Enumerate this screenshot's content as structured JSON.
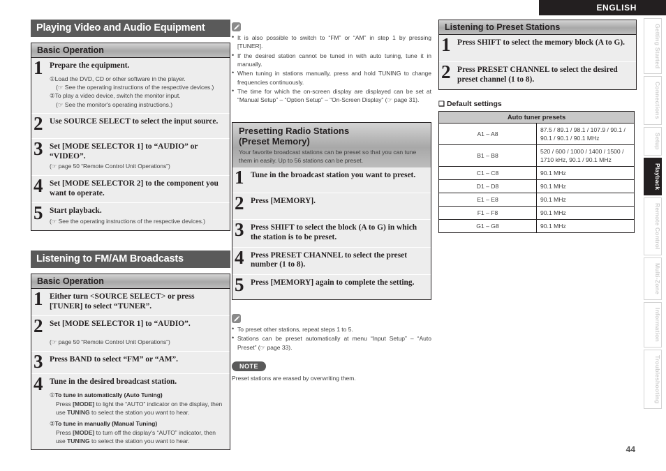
{
  "header": {
    "language_label": "ENGLISH",
    "page_number": "44"
  },
  "side_tabs": [
    {
      "label": "Getting Started",
      "active": false
    },
    {
      "label": "Connections",
      "active": false
    },
    {
      "label": "Setup",
      "active": false
    },
    {
      "label": "Playback",
      "active": true
    },
    {
      "label": "Remote Control",
      "active": false
    },
    {
      "label": "Multi-Zone",
      "active": false
    },
    {
      "label": "Information",
      "active": false
    },
    {
      "label": "Troubleshooting",
      "active": false
    }
  ],
  "column1": {
    "section1": {
      "heading": "Playing Video and Audio Equipment",
      "panel_heading": "Basic Operation",
      "steps": [
        {
          "num": "1",
          "title": "Prepare the equipment.",
          "items": [
            {
              "marker": "①",
              "text": "Load the DVD, CD or other software in the player."
            },
            {
              "marker": "",
              "text": "(☞ See the operating instructions of the respective devices.)"
            },
            {
              "marker": "②",
              "text": "To play a video device, switch the monitor input."
            },
            {
              "marker": "",
              "text": "(☞ See the monitor's operating instructions.)"
            }
          ]
        },
        {
          "num": "2",
          "title": "Use SOURCE SELECT to select the input source.",
          "sub": ""
        },
        {
          "num": "3",
          "title": "Set [MODE SELECTOR 1] to “AUDIO” or “VIDEO”.",
          "sub": "(☞ page 50 “Remote Control Unit Operations”)"
        },
        {
          "num": "4",
          "title": "Set [MODE SELECTOR 2] to the component you want to operate.",
          "sub": ""
        },
        {
          "num": "5",
          "title": "Start playback.",
          "sub": "(☞ See the operating instructions of the respective devices.)"
        }
      ]
    },
    "section2": {
      "heading": "Listening to FM/AM Broadcasts",
      "panel_heading": "Basic Operation",
      "steps": [
        {
          "num": "1",
          "title": "Either turn <SOURCE SELECT> or press [TUNER] to select “TUNER”.",
          "sub": ""
        },
        {
          "num": "2",
          "title": "Set [MODE SELECTOR 1] to “AUDIO”.",
          "sub": "(☞ page 50 “Remote Control Unit Operations”)"
        },
        {
          "num": "3",
          "title": "Press BAND to select “FM” or “AM”.",
          "sub": ""
        },
        {
          "num": "4",
          "title": "Tune in the desired broadcast station.",
          "tuning": [
            {
              "marker": "①",
              "label": "To tune in automatically (Auto Tuning)",
              "text_a": "Press ",
              "key_a": "[MODE]",
              "text_b": " to light the “AUTO” indicator on the display, then use ",
              "key_b": "TUNING",
              "text_c": " to select the station you want to hear."
            },
            {
              "marker": "②",
              "label": "To tune in manually (Manual Tuning)",
              "text_a": "Press ",
              "key_a": "[MODE]",
              "text_b": " to turn off the display's “AUTO” indicator, then use ",
              "key_b": "TUNING",
              "text_c": " to select the station you want to hear."
            }
          ]
        }
      ]
    }
  },
  "column2": {
    "memo_icon": "pencil-icon",
    "memo_bullets": [
      "It is also possible to switch to “FM” or “AM” in step 1 by pressing [TUNER].",
      "If the desired station cannot be tuned in with auto tuning, tune it in manually.",
      "When tuning in stations manually, press and hold TUNING to change frequencies continuously.",
      "The time for which the on-screen display are displayed can be set at “Manual Setup” – “Option Setup” – “On-Screen Display” (☞ page 31)."
    ],
    "panel": {
      "title_line1": "Presetting Radio Stations",
      "title_line2": "(Preset Memory)",
      "description": "Your favorite broadcast stations can be preset so that you can tune them in easily. Up to 56 stations can be preset."
    },
    "steps": [
      {
        "num": "1",
        "title": "Tune in the broadcast station you want to preset."
      },
      {
        "num": "2",
        "title": "Press [MEMORY]."
      },
      {
        "num": "3",
        "title": "Press SHIFT to select the block (A to G) in which the station is to be preset."
      },
      {
        "num": "4",
        "title": "Press PRESET CHANNEL to select the preset number (1 to 8)."
      },
      {
        "num": "5",
        "title": "Press [MEMORY] again to complete the setting."
      }
    ],
    "memo2_icon": "pencil-icon",
    "memo2_bullets": [
      "To preset other stations, repeat steps 1 to 5.",
      "Stations can be preset automatically at menu “Input Setup” – “Auto Preset” (☞ page 33)."
    ],
    "note_badge": "NOTE",
    "note_text": "Preset stations are erased by overwriting them."
  },
  "column3": {
    "panel_heading": "Listening to Preset Stations",
    "steps": [
      {
        "num": "1",
        "title": "Press SHIFT to select the memory block (A to G)."
      },
      {
        "num": "2",
        "title": "Press PRESET CHANNEL to select the desired preset channel (1 to 8)."
      }
    ],
    "default_settings_title": "Default settings",
    "table": {
      "header": "Auto tuner presets",
      "rows": [
        {
          "key": "A1 – A8",
          "value": "87.5 / 89.1 / 98.1 / 107.9 / 90.1 / 90.1 / 90.1 / 90.1 MHz"
        },
        {
          "key": "B1 – B8",
          "value": "520 / 600 / 1000 / 1400 / 1500 / 1710 kHz, 90.1 / 90.1 MHz"
        },
        {
          "key": "C1 – C8",
          "value": "90.1 MHz"
        },
        {
          "key": "D1 – D8",
          "value": "90.1 MHz"
        },
        {
          "key": "E1 – E8",
          "value": "90.1 MHz"
        },
        {
          "key": "F1 – F8",
          "value": "90.1 MHz"
        },
        {
          "key": "G1 – G8",
          "value": "90.1 MHz"
        }
      ]
    }
  }
}
